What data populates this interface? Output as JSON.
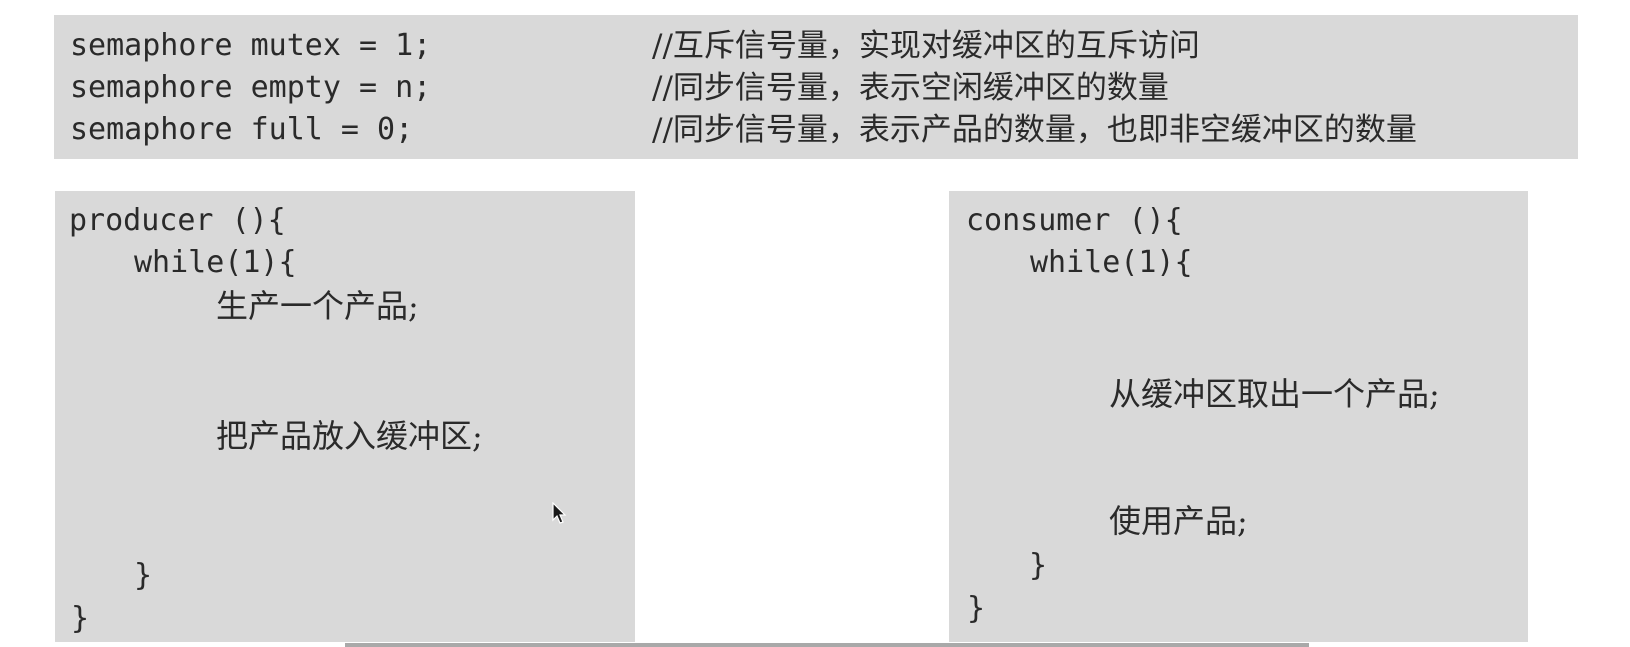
{
  "declarations": [
    {
      "code": "semaphore mutex = 1;",
      "comment": "//互斥信号量，实现对缓冲区的互斥访问"
    },
    {
      "code": "semaphore empty = n;",
      "comment": "//同步信号量，表示空闲缓冲区的数量"
    },
    {
      "code": "semaphore full = 0;",
      "comment": "//同步信号量，表示产品的数量，也即非空缓冲区的数量"
    }
  ],
  "producer": {
    "header": "producer (){",
    "loop": "while(1){",
    "step1": "生产一个产品;",
    "step2": "把产品放入缓冲区;",
    "loop_close": "}",
    "close": "}"
  },
  "consumer": {
    "header": "consumer (){",
    "loop": "while(1){",
    "step1": "从缓冲区取出一个产品;",
    "step2": "使用产品;",
    "loop_close": "}",
    "close": "}"
  },
  "icons": {
    "cursor": "mouse-pointer-icon"
  },
  "colors": {
    "panel_bg": "#d9d9d9",
    "text": "#2a2a2a",
    "page_bg": "#ffffff"
  }
}
